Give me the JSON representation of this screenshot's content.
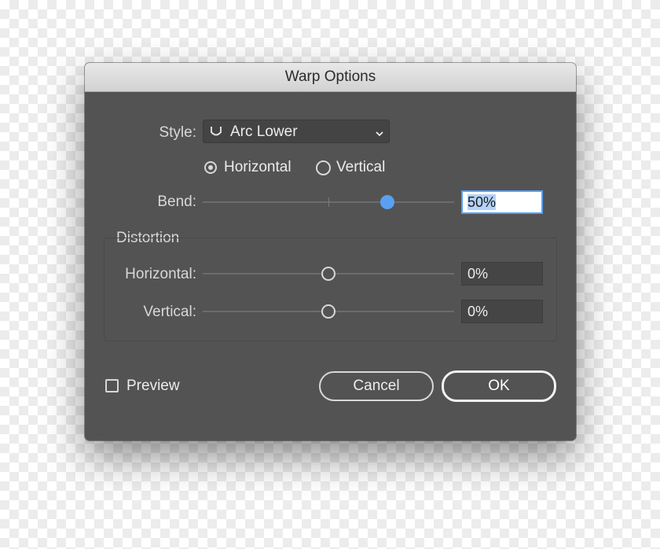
{
  "dialog": {
    "title": "Warp Options",
    "style_label": "Style:",
    "style_value": "Arc Lower",
    "style_icon": "arc-lower-icon",
    "orientation": {
      "horizontal_label": "Horizontal",
      "vertical_label": "Vertical",
      "selected": "Horizontal"
    },
    "bend": {
      "label": "Bend:",
      "value": "50%",
      "slider_percent": 50
    },
    "distortion": {
      "group_label": "Distortion",
      "horizontal_label": "Horizontal:",
      "horizontal_value": "0%",
      "horizontal_percent": 0,
      "vertical_label": "Vertical:",
      "vertical_value": "0%",
      "vertical_percent": 0
    },
    "preview_label": "Preview",
    "preview_checked": false,
    "cancel_label": "Cancel",
    "ok_label": "OK"
  },
  "colors": {
    "dialog_bg": "#535353",
    "accent": "#5aa0f2",
    "text": "#ececec"
  }
}
